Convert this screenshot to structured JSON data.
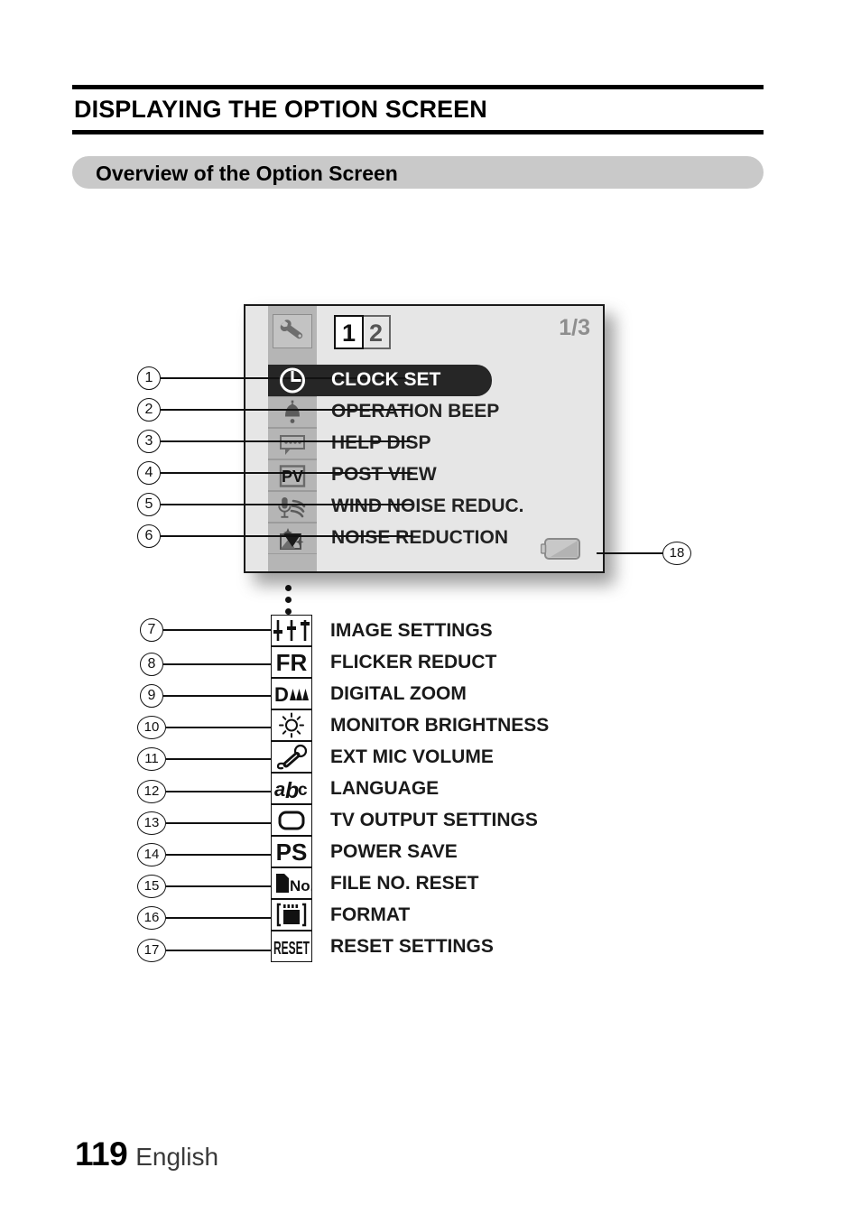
{
  "header": {
    "title": "DISPLAYING THE OPTION SCREEN",
    "section_title": "Overview of the Option Screen"
  },
  "lcd": {
    "wrench_icon": "wrench-icon",
    "tabs": [
      {
        "label": "1",
        "state": "active"
      },
      {
        "label": "2",
        "state": "inactive"
      }
    ],
    "page_indicator": "1/3",
    "down_arrow": "▼",
    "battery_icon": "battery-half-icon",
    "rows": [
      {
        "num": "1",
        "icon": "clock-icon",
        "label": "CLOCK SET",
        "highlighted": true
      },
      {
        "num": "2",
        "icon": "bell-icon",
        "label": "OPERATION BEEP",
        "highlighted": false
      },
      {
        "num": "3",
        "icon": "speech-bubble-icon",
        "label": "HELP DISP",
        "highlighted": false
      },
      {
        "num": "4",
        "icon": "pv-icon",
        "label": "POST VIEW",
        "highlighted": false
      },
      {
        "num": "5",
        "icon": "mic-wind-icon",
        "label": "WIND NOISE REDUC.",
        "highlighted": false
      },
      {
        "num": "6",
        "icon": "noise-reduce-icon",
        "label": "NOISE REDUCTION",
        "highlighted": false
      }
    ]
  },
  "lower_list": [
    {
      "num": "7",
      "icon": "sliders-icon",
      "label": "IMAGE SETTINGS"
    },
    {
      "num": "8",
      "icon": "fr-icon",
      "label": "FLICKER REDUCT"
    },
    {
      "num": "9",
      "icon": "digital-zoom-icon",
      "label": "DIGITAL ZOOM"
    },
    {
      "num": "10",
      "icon": "brightness-icon",
      "label": "MONITOR BRIGHTNESS"
    },
    {
      "num": "11",
      "icon": "ext-mic-icon",
      "label": "EXT MIC VOLUME"
    },
    {
      "num": "12",
      "icon": "abc-icon",
      "label": "LANGUAGE"
    },
    {
      "num": "13",
      "icon": "tv-icon",
      "label": "TV OUTPUT SETTINGS"
    },
    {
      "num": "14",
      "icon": "ps-icon",
      "label": "POWER SAVE"
    },
    {
      "num": "15",
      "icon": "file-no-icon",
      "label": "FILE NO. RESET"
    },
    {
      "num": "16",
      "icon": "format-card-icon",
      "label": "FORMAT"
    },
    {
      "num": "17",
      "icon": "reset-icon",
      "label": "RESET SETTINGS"
    }
  ],
  "battery_callout": {
    "num": "18"
  },
  "footer": {
    "page_number": "119",
    "language": "English"
  },
  "colors": {
    "section_bar": "#c9c9c9",
    "lcd_background": "#e6e6e6",
    "lcd_rail": "#b5b5b5",
    "highlight": "#262626",
    "page_indicator": "#8e8e8e"
  }
}
